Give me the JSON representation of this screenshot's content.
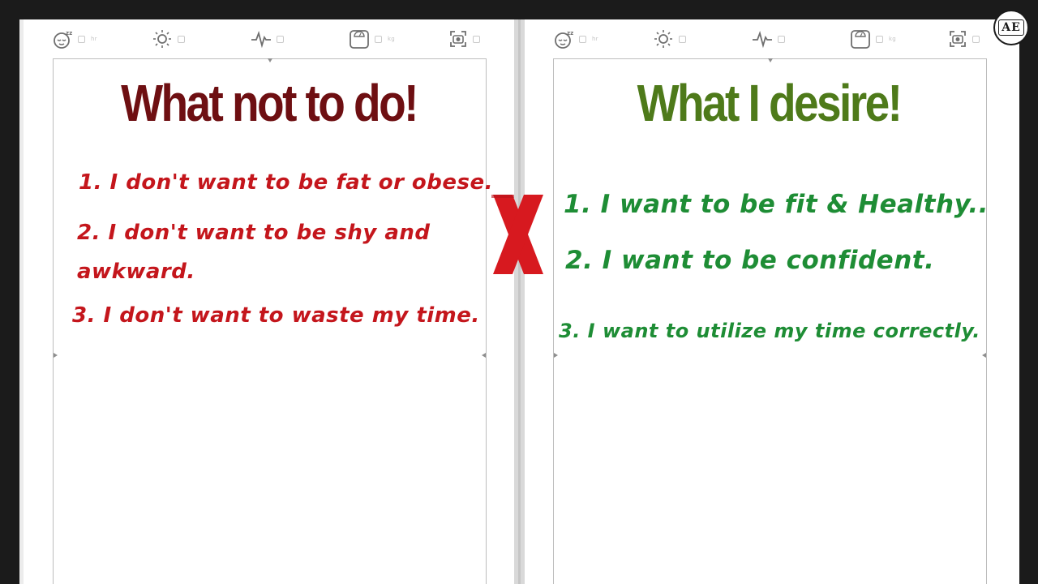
{
  "left_page": {
    "heading": "What not to do!",
    "heading_color": "#6e0f12",
    "item_color": "#c4161c",
    "items": [
      "1. I don't want to be fat or obese.",
      "2. I don't want to be shy and",
      "awkward.",
      "3. I don't want to waste my time."
    ]
  },
  "right_page": {
    "heading": "What I desire!",
    "heading_color": "#4e7a1a",
    "item_color": "#1e8d35",
    "items": [
      "1. I want to be fit & Healthy..",
      "2. I want to be confident.",
      "3. I want to utilize my time correctly."
    ]
  },
  "toolbar_icons": [
    "sleep-icon",
    "sun-icon",
    "heartbeat-icon",
    "scale-icon",
    "camera-icon"
  ],
  "divider_mark": {
    "color": "#d7191f",
    "icon": "x-mark-icon"
  },
  "badge": {
    "text": "AE"
  }
}
